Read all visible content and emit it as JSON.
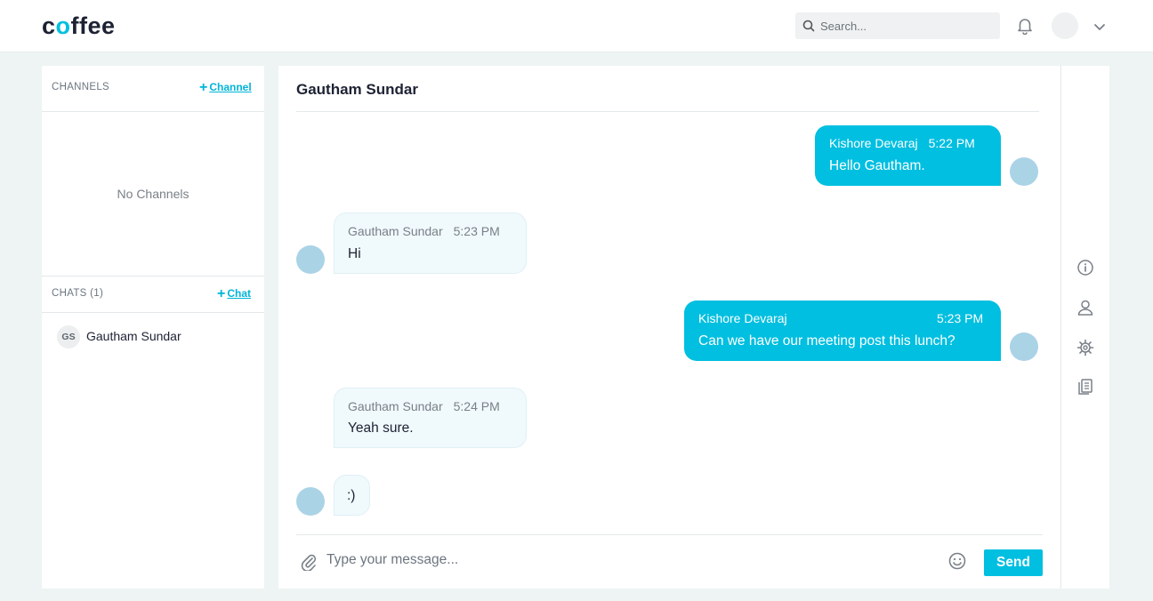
{
  "app": {
    "logo_pre": "c",
    "logo_o": "o",
    "logo_post": "ffee"
  },
  "search": {
    "placeholder": "Search..."
  },
  "sidebar": {
    "channels_title": "CHANNELS",
    "add_channel": "Channel",
    "no_channels": "No Channels",
    "chats_title": "CHATS (1)",
    "add_chat": "Chat",
    "chats": [
      {
        "initials": "GS",
        "name": "Gautham Sundar"
      }
    ]
  },
  "conversation": {
    "title": "Gautham Sundar",
    "messages": [
      {
        "direction": "out",
        "sender": "Kishore Devaraj",
        "time": "5:22 PM",
        "text": "Hello Gautham."
      },
      {
        "direction": "in",
        "sender": "Gautham Sundar",
        "time": "5:23 PM",
        "text": "Hi"
      },
      {
        "direction": "out",
        "sender": "Kishore Devaraj",
        "time": "5:23 PM",
        "text": "Can we have our meeting post this lunch?"
      },
      {
        "direction": "in",
        "sender": "Gautham Sundar",
        "time": "5:24 PM",
        "text": "Yeah sure."
      },
      {
        "direction": "in",
        "sender": "",
        "time": "",
        "text": ":)"
      }
    ]
  },
  "composer": {
    "placeholder": "Type your message...",
    "send_label": "Send"
  },
  "rail": {
    "icons": [
      "info-icon",
      "user-icon",
      "settings-icon",
      "documents-icon"
    ]
  },
  "colors": {
    "accent": "#00bfe0",
    "incoming_bubble": "#f0f9fc",
    "avatar": "#aad3e6"
  }
}
